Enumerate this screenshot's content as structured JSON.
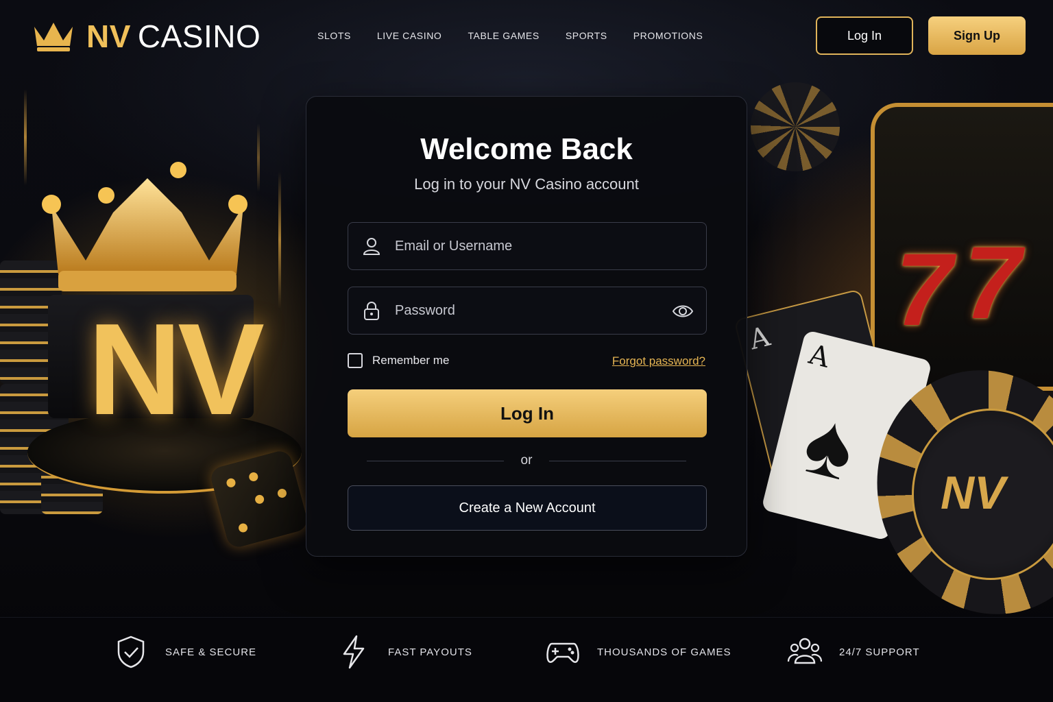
{
  "brand": {
    "name_part1": "NV",
    "name_part2": "CASINO",
    "accent_color": "#E8B54E",
    "logo_icon": "crown-icon"
  },
  "nav": {
    "items": [
      "SLOTS",
      "LIVE CASINO",
      "TABLE GAMES",
      "SPORTS",
      "PROMOTIONS"
    ]
  },
  "header": {
    "login_label": "Log In",
    "signup_label": "Sign Up"
  },
  "login": {
    "title": "Welcome Back",
    "subtitle": "Log in to your NV Casino account",
    "email_placeholder": "Email or Username",
    "email_icon": "user-icon",
    "password_placeholder": "Password",
    "password_icon": "lock-icon",
    "show_password_icon": "eye-icon",
    "remember_label": "Remember me",
    "forgot_label": "Forgot password?",
    "submit_label": "Log In",
    "divider_label": "or",
    "create_label": "Create a New Account"
  },
  "decor": {
    "pedestal_text": "NV",
    "chip_text": "NV",
    "slot_reel_symbol": "7",
    "card_rank": "A"
  },
  "features": [
    {
      "icon": "shield-check-icon",
      "label": "SAFE & SECURE"
    },
    {
      "icon": "lightning-icon",
      "label": "FAST PAYOUTS"
    },
    {
      "icon": "gamepad-icon",
      "label": "THOUSANDS OF GAMES"
    },
    {
      "icon": "users-icon",
      "label": "24/7 SUPPORT"
    }
  ]
}
